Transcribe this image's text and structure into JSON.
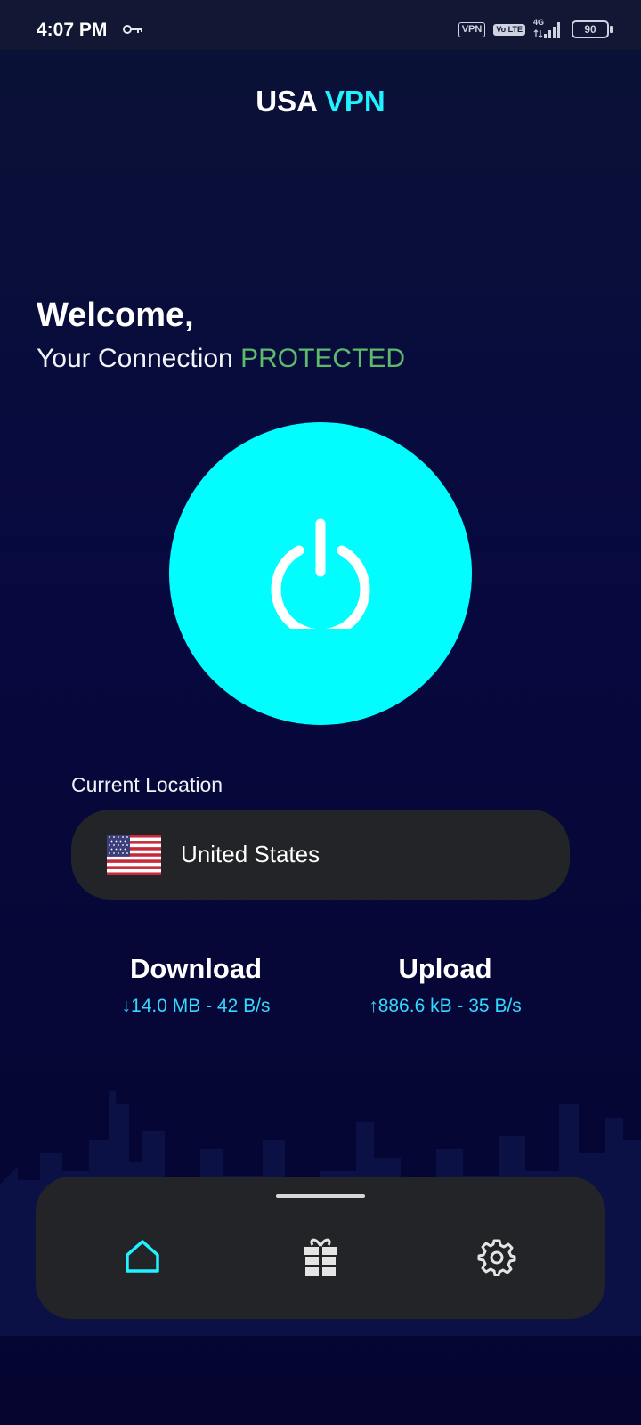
{
  "status_bar": {
    "time": "4:07 PM",
    "vpn_badge": "VPN",
    "volte_badge": "Vo LTE",
    "network": "4G",
    "battery": "90"
  },
  "app": {
    "title_main": "USA",
    "title_accent": "VPN"
  },
  "welcome": {
    "heading": "Welcome,",
    "connection_prefix": "Your Connection",
    "connection_status": "PROTECTED"
  },
  "power_button": {
    "icon": "power-icon"
  },
  "location": {
    "label": "Current Location",
    "country": "United States",
    "flag_icon": "us-flag-icon"
  },
  "stats": {
    "download_title": "Download",
    "download_value": "↓14.0 MB - 42 B/s",
    "upload_title": "Upload",
    "upload_value": "↑886.6 kB - 35 B/s"
  },
  "nav": {
    "items": [
      {
        "name": "home",
        "icon": "home-icon",
        "active": true
      },
      {
        "name": "gift",
        "icon": "gift-icon",
        "active": false
      },
      {
        "name": "settings",
        "icon": "gear-icon",
        "active": false
      }
    ]
  },
  "colors": {
    "accent": "#21f2ff",
    "power": "#02fdff",
    "protected": "#5cba6a",
    "stat_value": "#35d7ff",
    "card": "#232427"
  }
}
